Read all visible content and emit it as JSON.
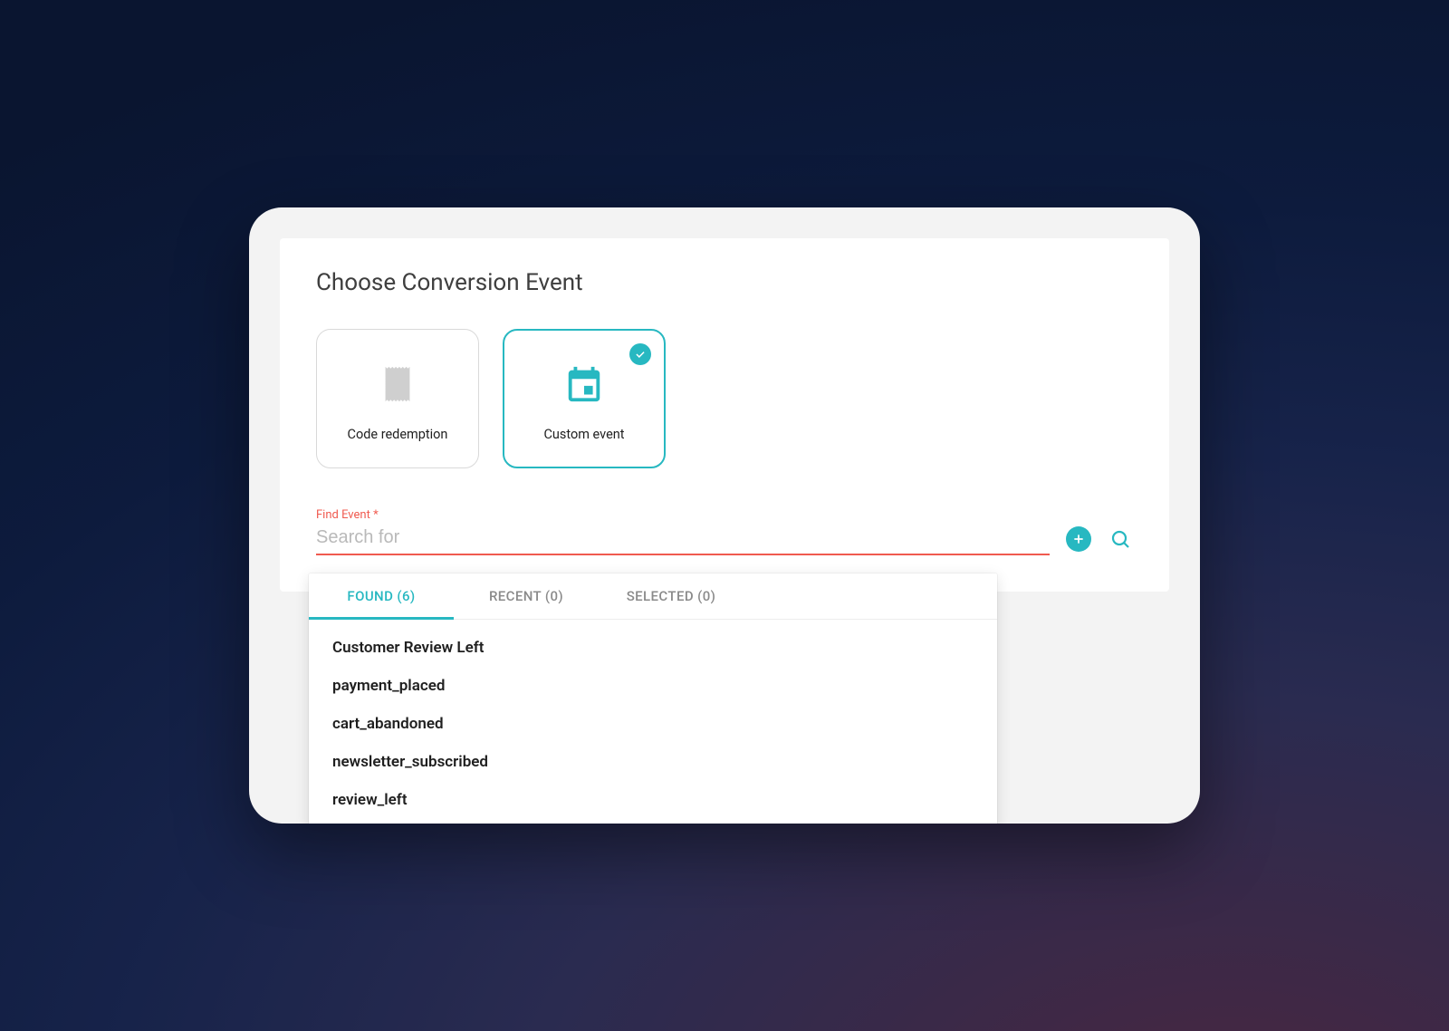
{
  "page": {
    "title": "Choose Conversion Event"
  },
  "cards": [
    {
      "id": "code-redemption",
      "label": "Code redemption",
      "selected": false
    },
    {
      "id": "custom-event",
      "label": "Custom event",
      "selected": true
    }
  ],
  "search": {
    "label": "Find Event *",
    "placeholder": "Search for",
    "value": ""
  },
  "tabs": [
    {
      "id": "found",
      "label": "FOUND (6)",
      "active": true
    },
    {
      "id": "recent",
      "label": "RECENT (0)",
      "active": false
    },
    {
      "id": "selected",
      "label": "SELECTED (0)",
      "active": false
    }
  ],
  "results": [
    "Customer Review Left",
    "payment_placed",
    "cart_abandoned",
    "newsletter_subscribed",
    "review_left"
  ],
  "colors": {
    "accent": "#27b8c1",
    "error": "#f05a4f"
  }
}
